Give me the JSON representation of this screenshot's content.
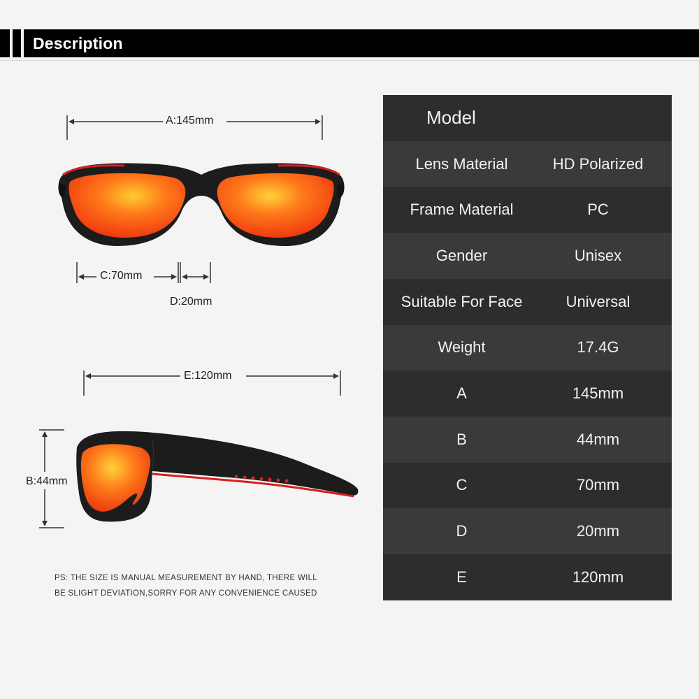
{
  "banner": {
    "title": "Description"
  },
  "dimensions": {
    "a": "A:145mm",
    "c": "C:70mm",
    "d": "D:20mm",
    "e": "E:120mm",
    "b": "B:44mm"
  },
  "note": {
    "line1": "PS: THE SIZE IS MANUAL MEASUREMENT BY HAND, THERE WILL",
    "line2": "BE SLIGHT DEVIATION,SORRY FOR ANY CONVENIENCE CAUSED"
  },
  "spec_table": {
    "header": "Model",
    "rows": [
      {
        "label": "Lens Material",
        "value": "HD Polarized"
      },
      {
        "label": "Frame Material",
        "value": "PC"
      },
      {
        "label": "Gender",
        "value": "Unisex"
      },
      {
        "label": "Suitable For Face",
        "value": "Universal"
      },
      {
        "label": "Weight",
        "value": "17.4G"
      },
      {
        "label": "A",
        "value": "145mm"
      },
      {
        "label": "B",
        "value": "44mm"
      },
      {
        "label": "C",
        "value": "70mm"
      },
      {
        "label": "D",
        "value": "20mm"
      },
      {
        "label": "E",
        "value": "120mm"
      }
    ]
  },
  "colors": {
    "banner": "#000000",
    "table_dark": "#2d2d2d",
    "table_light": "#3a3a3a",
    "lens": "#ff5a14",
    "frame": "#1c1c1c",
    "accent_red": "#d81f1f"
  }
}
